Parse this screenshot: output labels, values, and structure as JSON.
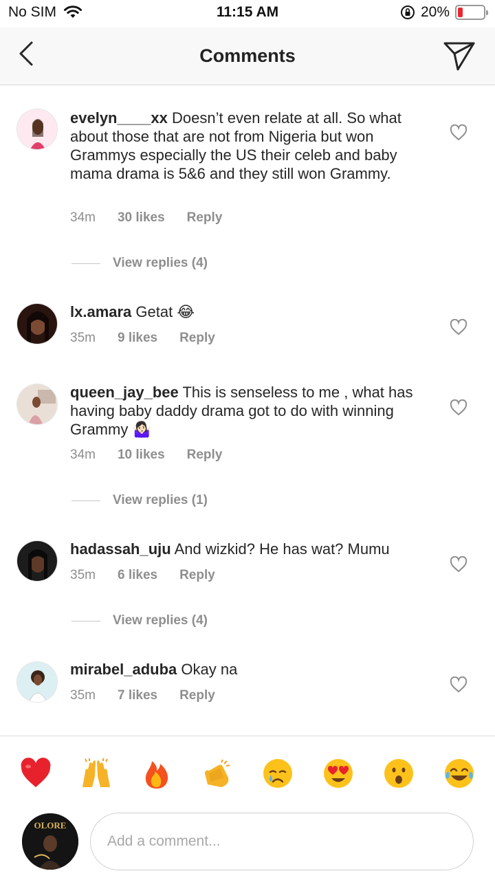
{
  "status_bar": {
    "carrier": "No SIM",
    "time": "11:15 AM",
    "battery": "20%",
    "battery_level": 0.2
  },
  "header": {
    "title": "Comments"
  },
  "comments": [
    {
      "username": "evelyn____xx",
      "text": "Doesn’t even relate at all. So what about those that are not from Nigeria but won Grammys especially the US their celeb and baby mama drama is 5&6 and they still won Grammy.",
      "time": "34m",
      "likes": "30 likes",
      "reply": "Reply",
      "view_replies": "View replies (4)"
    },
    {
      "username": "lx.amara",
      "text": "Getat 😂",
      "time": "35m",
      "likes": "9 likes",
      "reply": "Reply"
    },
    {
      "username": "queen_jay_bee",
      "text": "This is senseless to me , what has having baby daddy drama got to do with winning Grammy 🤷🏻‍♀️",
      "time": "34m",
      "likes": "10 likes",
      "reply": "Reply",
      "view_replies": "View replies (1)"
    },
    {
      "username": "hadassah_uju",
      "text": "And wizkid? He has wat? Mumu",
      "time": "35m",
      "likes": "6 likes",
      "reply": "Reply",
      "view_replies": "View replies (4)"
    },
    {
      "username": "mirabel_aduba",
      "text": "Okay na",
      "time": "35m",
      "likes": "7 likes",
      "reply": "Reply"
    }
  ],
  "emoji_bar": [
    "heart",
    "raising-hands",
    "fire",
    "clapping-hands",
    "crying-face",
    "heart-eyes",
    "surprised-face",
    "tears-of-joy"
  ],
  "composer": {
    "placeholder": "Add a comment...",
    "avatar_text": "OLORE"
  }
}
